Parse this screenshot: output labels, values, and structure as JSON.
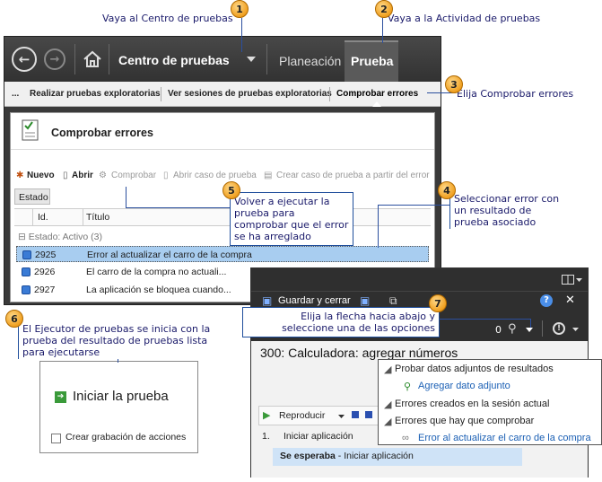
{
  "window": {
    "hub": "Centro de pruebas",
    "tabs": [
      "Planeación",
      "Prueba"
    ],
    "subtabs": [
      "...",
      "Realizar pruebas exploratorias",
      "Ver sesiones de pruebas exploratorias",
      "Comprobar errores"
    ],
    "page_title": "Comprobar errores",
    "toolbar": {
      "new": "Nuevo",
      "open": "Abrir",
      "verify": "Comprobar",
      "open_case": "Abrir caso de prueba",
      "create_case": "Crear caso de prueba a partir del error"
    },
    "filter_label": "Estado",
    "columns": [
      "Id.",
      "Título"
    ],
    "group": "Estado: Activo (3)",
    "rows": [
      {
        "id": "2925",
        "title": "Error al actualizar el carro de la compra"
      },
      {
        "id": "2926",
        "title": "El carro de la compra no actuali..."
      },
      {
        "id": "2927",
        "title": "La aplicación se bloquea cuando..."
      }
    ]
  },
  "runner": {
    "save_close": "Guardar y cerrar",
    "count": "0",
    "title": "300: Calculadora: agregar números",
    "play": "Reproducir",
    "step_num": "1.",
    "step": "Iniciar aplicación",
    "expected_bold": "Se esperaba",
    "expected_rest": " - Iniciar aplicación"
  },
  "dropdown": {
    "h1": "Probar datos adjuntos de resultados",
    "link1": "Agregar dato adjunto",
    "h2": "Errores creados en la sesión actual",
    "h3": "Errores que hay que comprobar",
    "link2": "Error al actualizar el carro de la compra"
  },
  "panel6": {
    "start": "Iniciar la prueba",
    "record": "Crear grabación de acciones"
  },
  "callouts": {
    "c1": "Vaya al Centro de pruebas",
    "c2": "Vaya a la Actividad de pruebas",
    "c3": "Elija Comprobar errores",
    "c4": "Seleccionar error con un resultado de prueba asociado",
    "c5": "Volver a ejecutar la prueba para comprobar que el error se ha arreglado",
    "c6": "El Ejecutor de pruebas se inicia con la prueba del resultado de pruebas lista para ejecutarse",
    "c7": "Elija la flecha hacia abajo y seleccione una de las opciones"
  },
  "badges": [
    "1",
    "2",
    "3",
    "4",
    "5",
    "6",
    "7"
  ],
  "colors": {
    "accent": "#f0a020",
    "callout_text": "#1a1a6a",
    "selected_row": "#a8cdf0",
    "link": "#1a5fb4"
  }
}
